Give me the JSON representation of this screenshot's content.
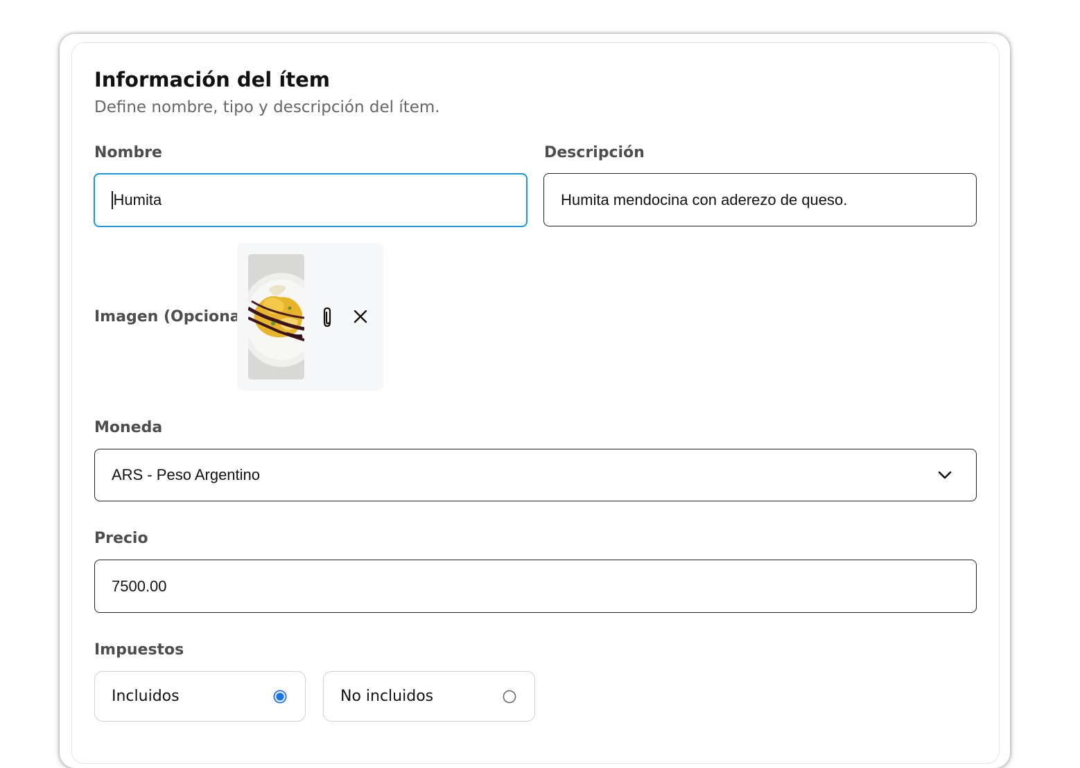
{
  "section": {
    "title": "Información del ítem",
    "subtitle": "Define nombre, tipo y descripción del ítem."
  },
  "nombre": {
    "label": "Nombre",
    "value": "Humita"
  },
  "descripcion": {
    "label": "Descripción",
    "value": "Humita mendocina con aderezo de queso."
  },
  "imagen": {
    "label": "Imagen (Opcional)",
    "attach_icon": "paperclip-icon",
    "remove_icon": "close-icon"
  },
  "moneda": {
    "label": "Moneda",
    "selected": "ARS - Peso Argentino"
  },
  "precio": {
    "label": "Precio",
    "value": "7500.00"
  },
  "impuestos": {
    "label": "Impuestos",
    "options": [
      {
        "label": "Incluidos",
        "selected": true
      },
      {
        "label": "No incluidos",
        "selected": false
      }
    ]
  },
  "colors": {
    "focus_border": "#1a95e6",
    "radio_selected": "#1a73e8",
    "label_text": "#4d4d4d",
    "subtitle_text": "#666666"
  }
}
